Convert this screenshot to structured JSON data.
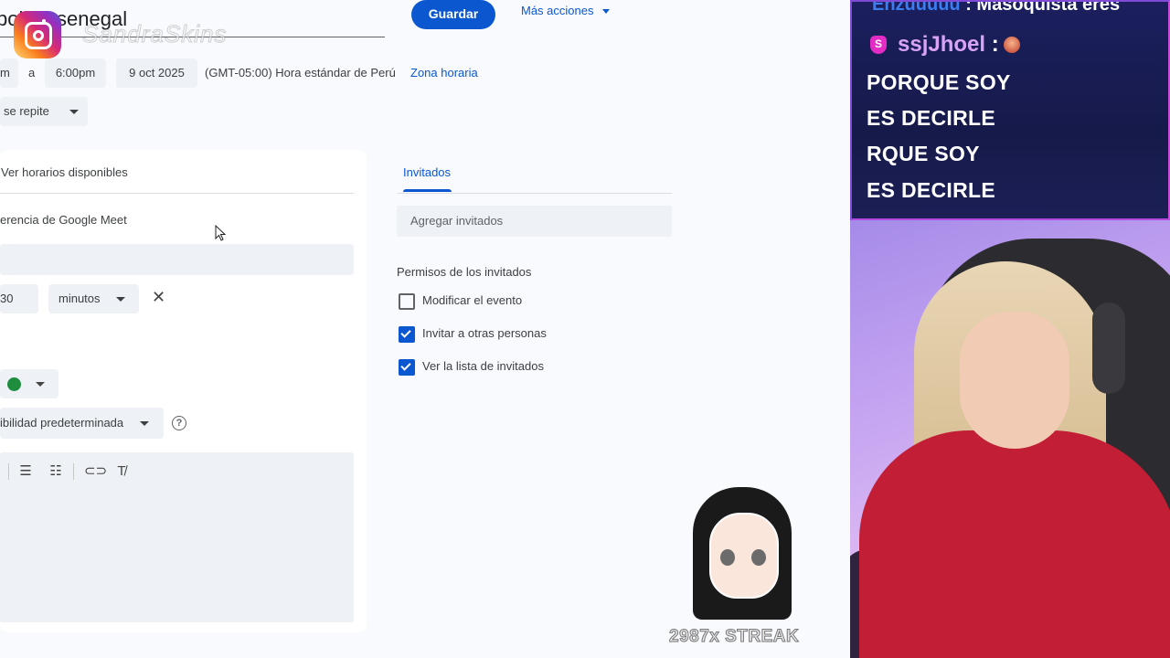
{
  "calendar": {
    "title_fragment": "pol    de senegal",
    "save_label": "Guardar",
    "more_actions_label": "Más acciones",
    "time_start_fragment": "m",
    "to_label": "a",
    "time_end": "6:00pm",
    "date_end": "9 oct 2025",
    "timezone_text": "(GMT-05:00) Hora estándar de Perú",
    "timezone_link": "Zona horaria",
    "repeat_label": "se repite",
    "availability_label": "Ver horarios disponibles",
    "meet_label": "erencia de Google Meet",
    "notification_value": "30",
    "notification_unit": "minutos",
    "close_symbol": "✕",
    "visibility_label": "ibilidad predeterminada",
    "help_symbol": "?",
    "event_color": "#1e8e3e"
  },
  "guests": {
    "tab_label": "Invitados",
    "add_placeholder": "Agregar invitados",
    "permissions_title": "Permisos de los invitados",
    "permissions": [
      {
        "label": "Modificar el evento",
        "checked": false
      },
      {
        "label": "Invitar a otras personas",
        "checked": true
      },
      {
        "label": "Ver la lista de invitados",
        "checked": true
      }
    ]
  },
  "overlay": {
    "instagram_handle": "SandraSkins",
    "chat_top_user": "Enzuuuuu",
    "chat_top_message": ": Masoquista eres",
    "chat_user": "ssjJhoel",
    "chat_user_colon": ":",
    "badge_letter": "S",
    "chat_lines": [
      "PORQUE SOY",
      "ES DECIRLE",
      "RQUE SOY",
      "ES DECIRLE"
    ],
    "streak_text": "2987x STREAK"
  },
  "colors": {
    "accent": "#0b57d0",
    "checkbox_on": "#0b57d0",
    "chat_bg": "#1b1f5e",
    "hoodie": "#c21f36"
  }
}
